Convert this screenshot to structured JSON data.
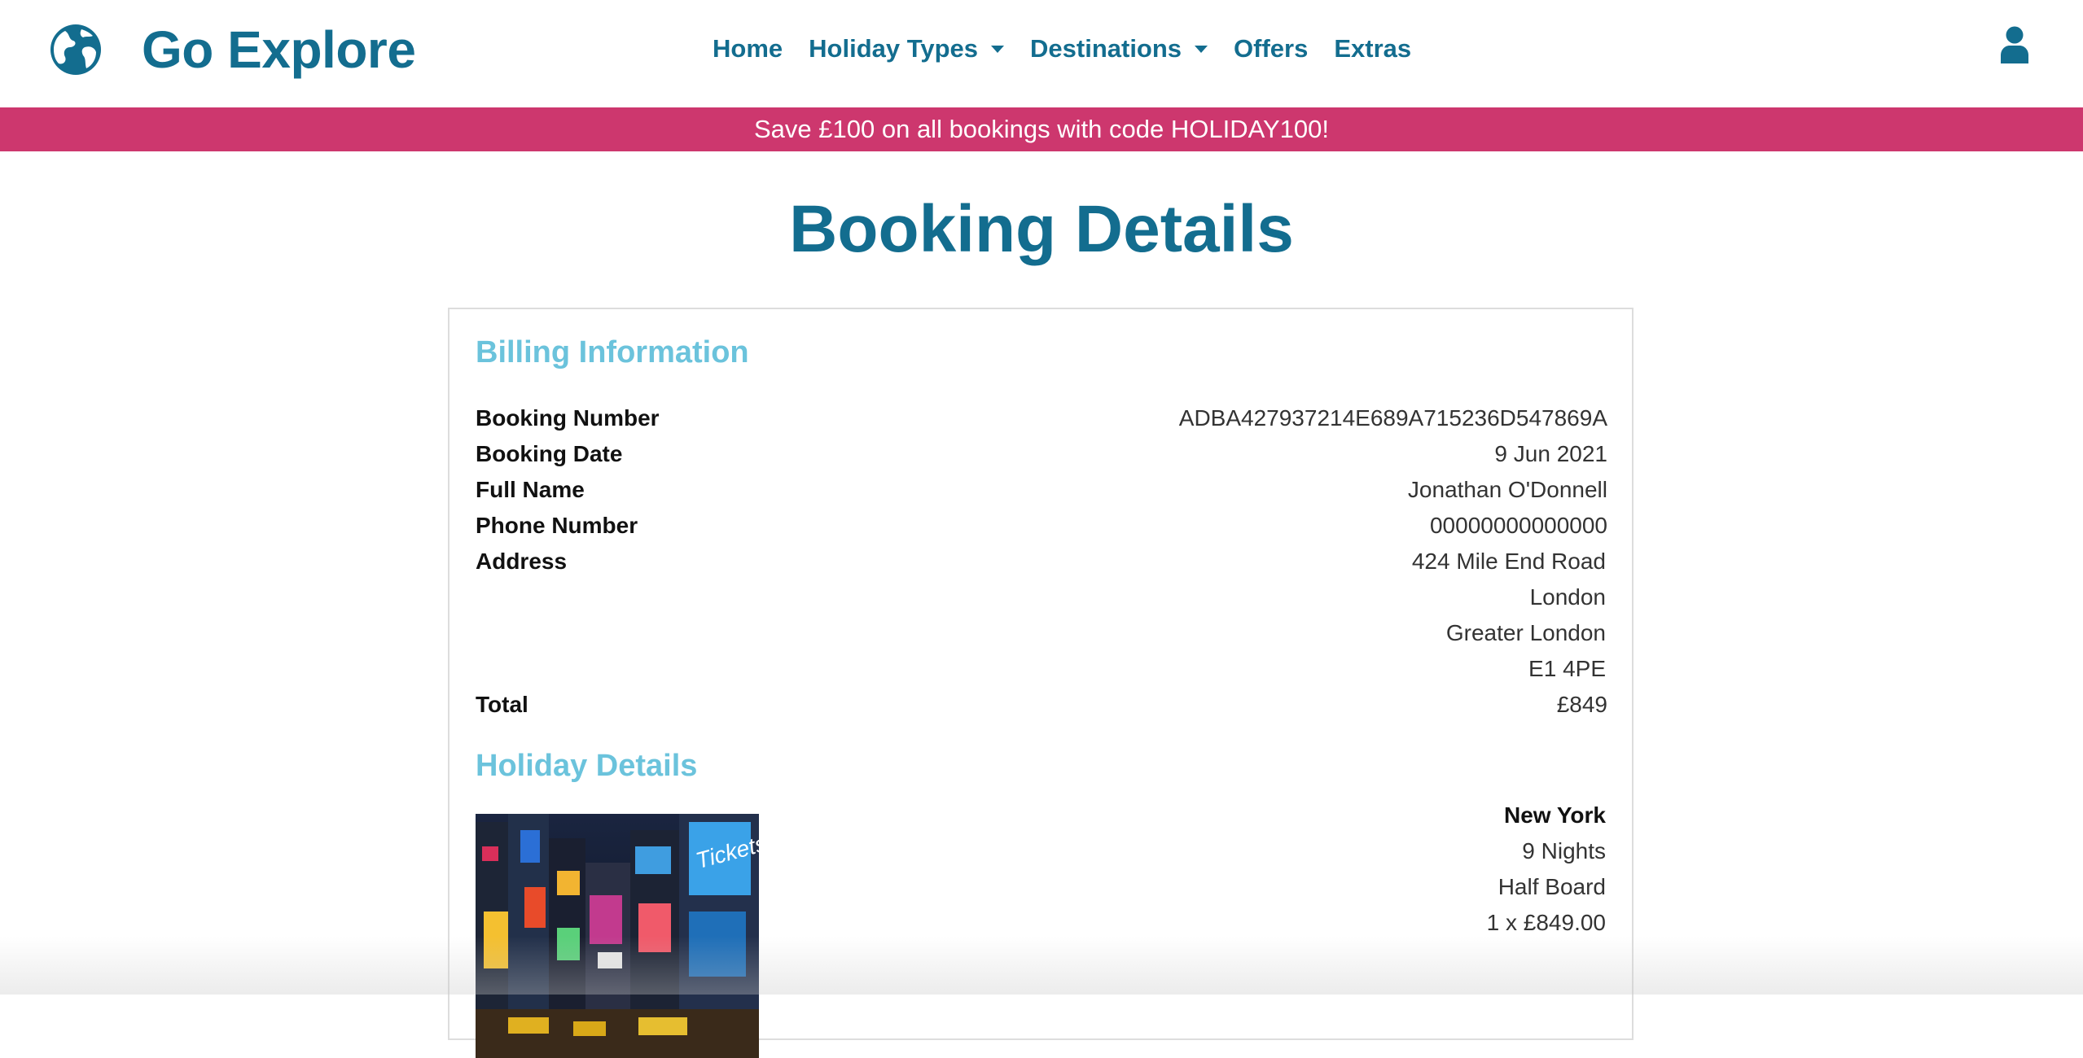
{
  "brand": {
    "name": "Go Explore",
    "icon": "globe-icon"
  },
  "nav": {
    "home": "Home",
    "holiday_types": "Holiday Types",
    "destinations": "Destinations",
    "offers": "Offers",
    "extras": "Extras"
  },
  "account_icon": "user-icon",
  "promo": {
    "text": "Save £100 on all bookings with code HOLIDAY100!"
  },
  "page_title": "Booking Details",
  "billing": {
    "heading": "Billing Information",
    "booking_number_label": "Booking Number",
    "booking_number": "ADBA427937214E689A715236D547869A",
    "booking_date_label": "Booking Date",
    "booking_date": "9 Jun 2021",
    "full_name_label": "Full Name",
    "full_name": "Jonathan O'Donnell",
    "phone_label": "Phone Number",
    "phone": "00000000000000",
    "address_label": "Address",
    "address": [
      "424 Mile End Road",
      "London",
      "Greater London",
      "E1 4PE"
    ],
    "total_label": "Total",
    "total": "£849"
  },
  "holiday": {
    "heading": "Holiday Details",
    "destination": "New York",
    "nights": "9 Nights",
    "board": "Half Board",
    "price_line": "1 x £849.00"
  },
  "colors": {
    "brand": "#136d8f",
    "promo_bg": "#cd376e",
    "section_heading": "#6bc3dc"
  }
}
